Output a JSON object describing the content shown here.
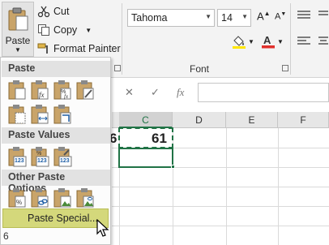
{
  "clipboard": {
    "paste_label": "Paste",
    "cut_label": "Cut",
    "copy_label": "Copy",
    "format_painter_label": "Format Painter"
  },
  "font": {
    "name": "Tahoma",
    "size": "14",
    "group_label": "Font",
    "font_color": "#e0302c",
    "highlight_color": "#ffe600"
  },
  "formula_bar": {
    "cancel_glyph": "✕",
    "enter_glyph": "✓",
    "fx_glyph": "fx"
  },
  "grid": {
    "columns": [
      "C",
      "D",
      "E",
      "F"
    ],
    "selected_column": "C",
    "cell_b_value": "6",
    "cell_c_value": "61",
    "row_partial_label": "6",
    "accent_color": "#217346"
  },
  "paste_menu": {
    "section_paste": "Paste",
    "section_paste_values": "Paste Values",
    "section_other": "Other Paste Options",
    "paste_special_label": "Paste Special...",
    "paste_icon_names": [
      "paste-icon",
      "paste-formulas-icon",
      "paste-formulas-number-formatting-icon",
      "keep-source-formatting-icon",
      "no-borders-icon",
      "keep-source-column-widths-icon",
      "transpose-icon"
    ],
    "paste_values_icon_names": [
      "paste-values-icon",
      "paste-values-number-formatting-icon",
      "paste-values-source-formatting-icon"
    ],
    "paste_values_badges": [
      "123",
      "123",
      "123"
    ],
    "other_icon_names": [
      "paste-formatting-icon",
      "paste-link-icon",
      "paste-picture-icon",
      "linked-picture-icon"
    ]
  }
}
